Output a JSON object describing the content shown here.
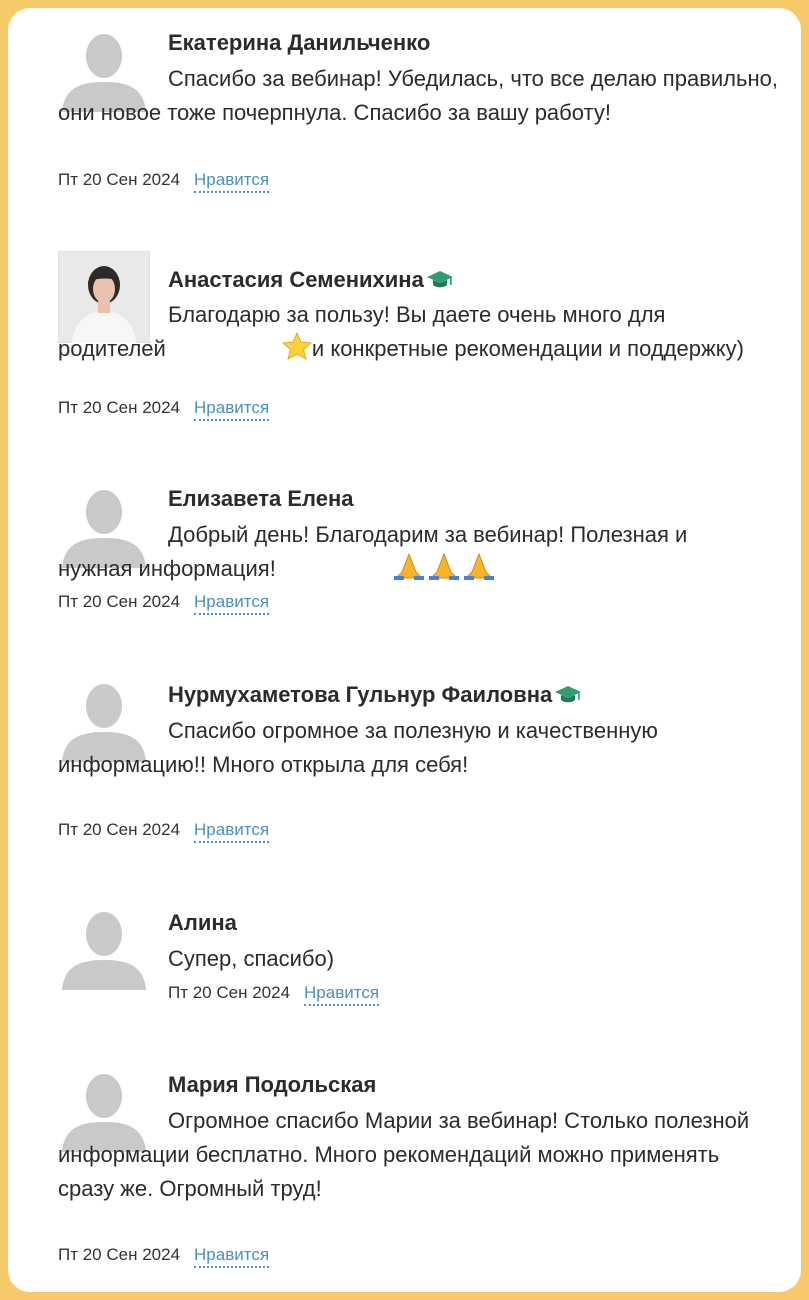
{
  "comments": [
    {
      "author": "Екатерина Данильченко",
      "text": "Спасибо за вебинар! Убедилась, что все делаю правильно, они новое тоже почерпнула. Спасибо за вашу работу!",
      "date": "Пт 20 Сен 2024",
      "like": "Нравится",
      "avatar": "default-avatar-icon"
    },
    {
      "author": "Анастасия Семенихина",
      "text_part1": "Благодарю за пользу! Вы даете очень много для родителей ",
      "text_part2": "и конкретные рекомендации и поддержку)",
      "date": "Пт 20 Сен 2024",
      "like": "Нравится",
      "avatar": "user-photo",
      "badge": "graduation-cap-icon",
      "emoji": "star-icon"
    },
    {
      "author": "Елизавета Елена",
      "text": "Добрый день! Благодарим за вебинар! Полезная и нужная информация! ",
      "date": "Пт 20 Сен 2024",
      "like": "Нравится",
      "avatar": "default-avatar-icon",
      "emoji": "folded-hands-icon"
    },
    {
      "author": "Нурмухаметова Гульнур Фаиловна",
      "text": "Спасибо огромное за полезную и качественную информацию!! Много открыла для себя!",
      "date": "Пт 20 Сен 2024",
      "like": "Нравится",
      "avatar": "default-avatar-icon",
      "badge": "graduation-cap-icon"
    },
    {
      "author": "Алина",
      "text": "Супер, спасибо)",
      "date": "Пт 20 Сен 2024",
      "like": "Нравится",
      "avatar": "default-avatar-icon"
    },
    {
      "author": "Мария Подольская",
      "text": "Огромное спасибо Марии за вебинар! Столько полезной информации бесплатно. Много рекомендаций можно применять сразу же. Огромный труд!",
      "date": "Пт 20 Сен 2024",
      "like": "Нравится",
      "avatar": "default-avatar-icon"
    }
  ],
  "colors": {
    "frame_border": "#f8c96a",
    "like_link": "#4a8fc0",
    "avatar_placeholder": "#c9c9c9",
    "badge": "#2e9e6a"
  }
}
